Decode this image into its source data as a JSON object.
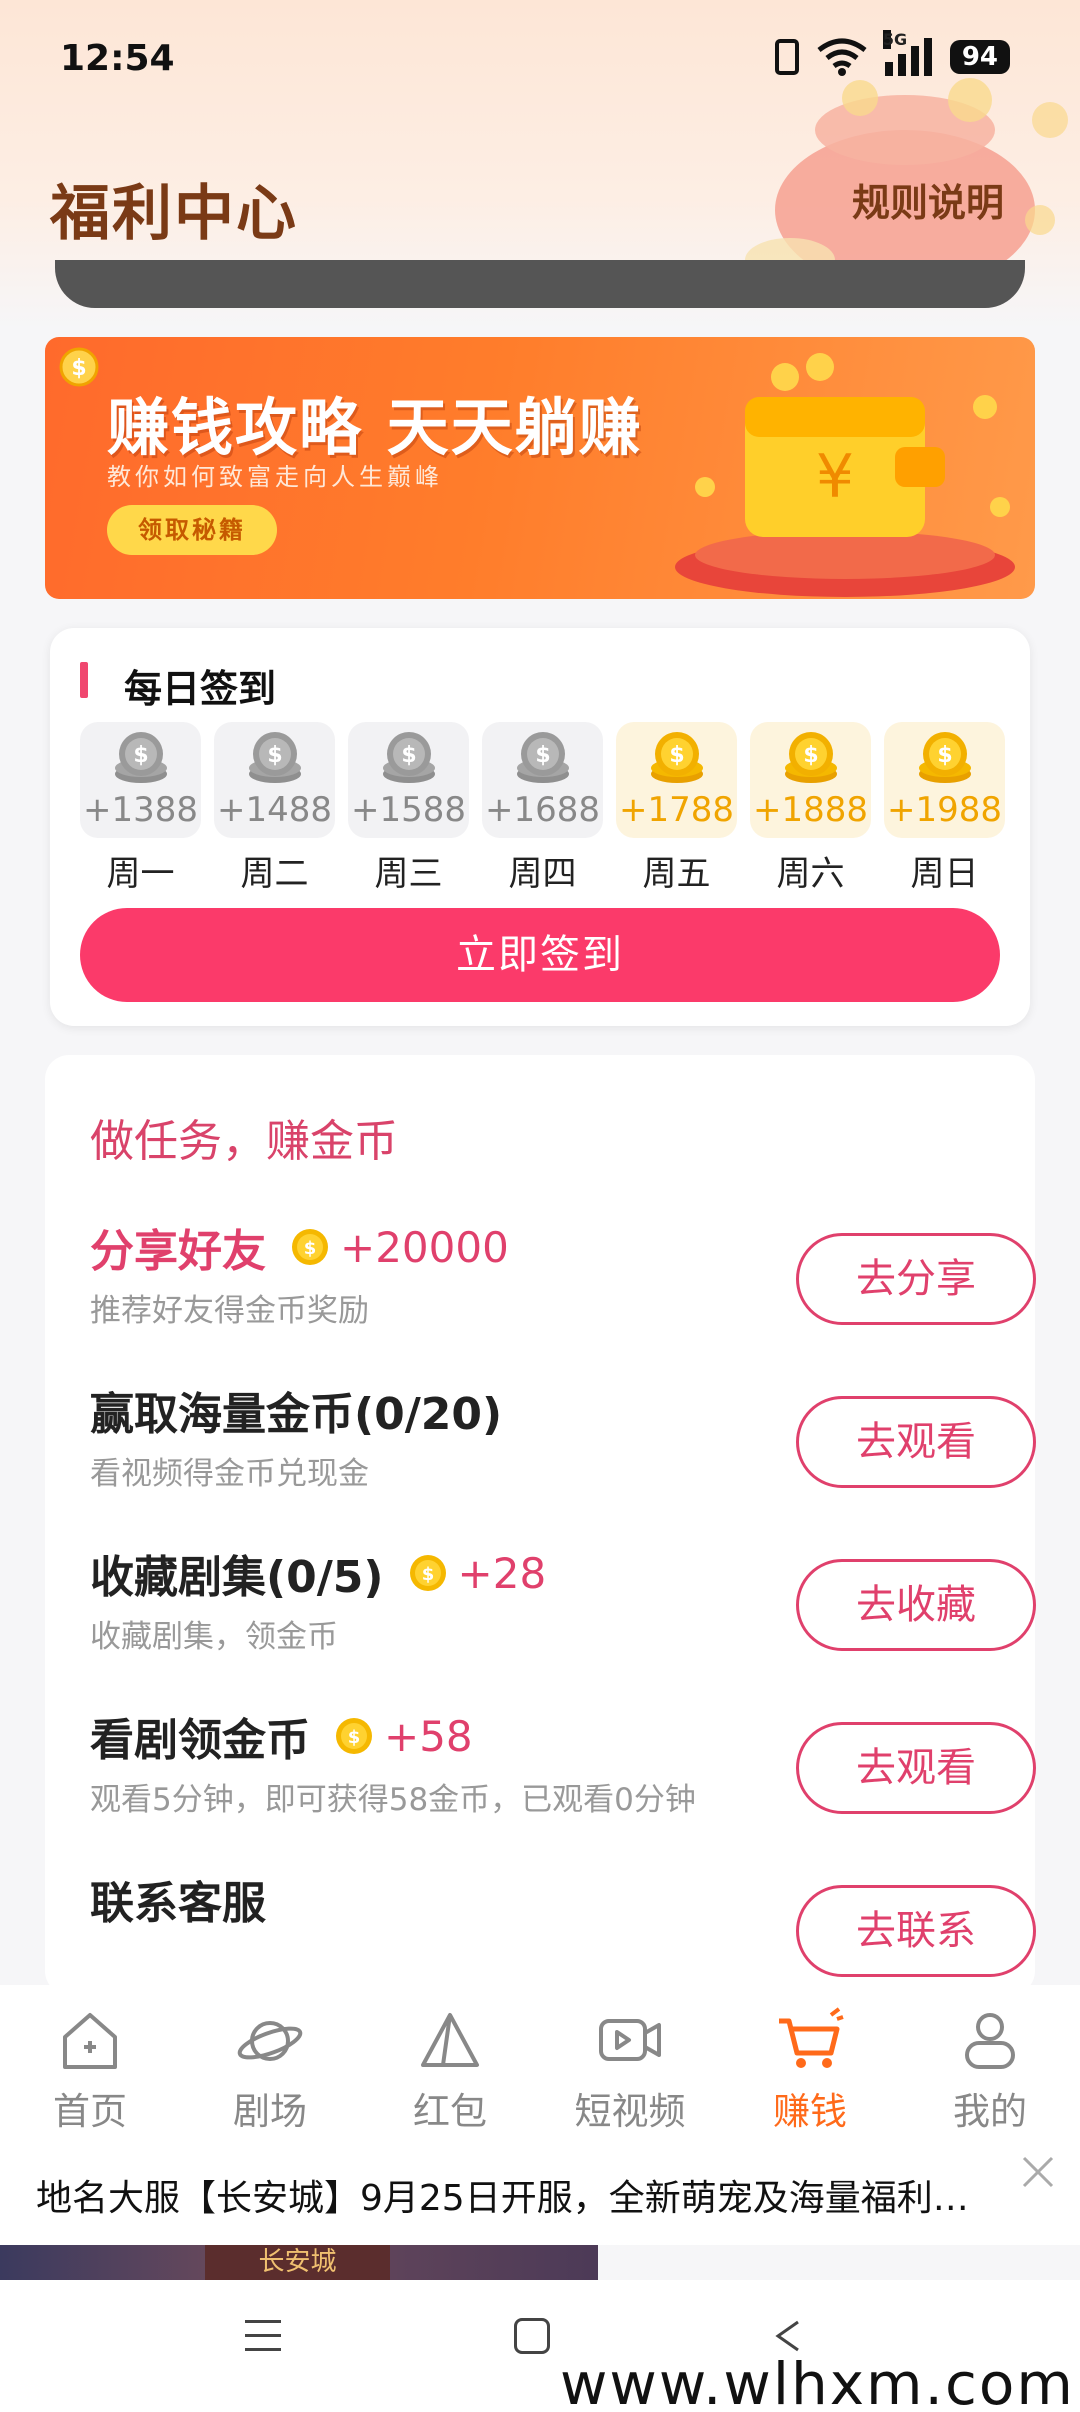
{
  "status_bar": {
    "time": "12:54",
    "network": "5G",
    "battery": "94"
  },
  "header": {
    "title": "福利中心",
    "rules_label": "规则说明"
  },
  "banner": {
    "title": "赚钱攻略 天天躺赚",
    "subtitle": "教你如何致富走向人生巅峰",
    "button_label": "领取秘籍"
  },
  "signin": {
    "title": "每日签到",
    "days": [
      {
        "amount": "+1388",
        "label": "周一",
        "state": "grey"
      },
      {
        "amount": "+1488",
        "label": "周二",
        "state": "grey"
      },
      {
        "amount": "+1588",
        "label": "周三",
        "state": "grey"
      },
      {
        "amount": "+1688",
        "label": "周四",
        "state": "grey"
      },
      {
        "amount": "+1788",
        "label": "周五",
        "state": "gold"
      },
      {
        "amount": "+1888",
        "label": "周六",
        "state": "gold"
      },
      {
        "amount": "+1988",
        "label": "周日",
        "state": "gold"
      }
    ],
    "button_label": "立即签到"
  },
  "tasks": {
    "heading": "做任务，赚金币",
    "items": [
      {
        "title": "分享好友",
        "reward": "+20000",
        "desc": "推荐好友得金币奖励",
        "button": "去分享"
      },
      {
        "title": "赢取海量金币(0/20)",
        "reward": "",
        "desc": "看视频得金币兑现金",
        "button": "去观看"
      },
      {
        "title": "收藏剧集(0/5)",
        "reward": "+28",
        "desc": "收藏剧集，领金币",
        "button": "去收藏"
      },
      {
        "title": "看剧领金币",
        "reward": "+58",
        "desc": "观看5分钟，即可获得58金币，已观看0分钟",
        "button": "去观看"
      },
      {
        "title": "联系客服",
        "reward": "",
        "desc": "",
        "button": "去联系"
      }
    ]
  },
  "bottom_nav": {
    "items": [
      {
        "label": "首页",
        "icon": "home-icon"
      },
      {
        "label": "剧场",
        "icon": "planet-icon"
      },
      {
        "label": "红包",
        "icon": "triangle-icon"
      },
      {
        "label": "短视频",
        "icon": "video-icon"
      },
      {
        "label": "赚钱",
        "icon": "cart-icon",
        "active": true
      },
      {
        "label": "我的",
        "icon": "profile-icon"
      }
    ]
  },
  "ad": {
    "text": "地名大服【长安城】9月25日开服，全新萌宠及海量福利…",
    "image_text": "长安城"
  },
  "watermark": "www.wlhxm.com",
  "colors": {
    "accent": "#fb3a6a",
    "task_pink": "#e0406c",
    "nav_active": "#ff6a1a",
    "title_brown": "#7a3a16",
    "banner_orange": "#ff6a2c"
  }
}
